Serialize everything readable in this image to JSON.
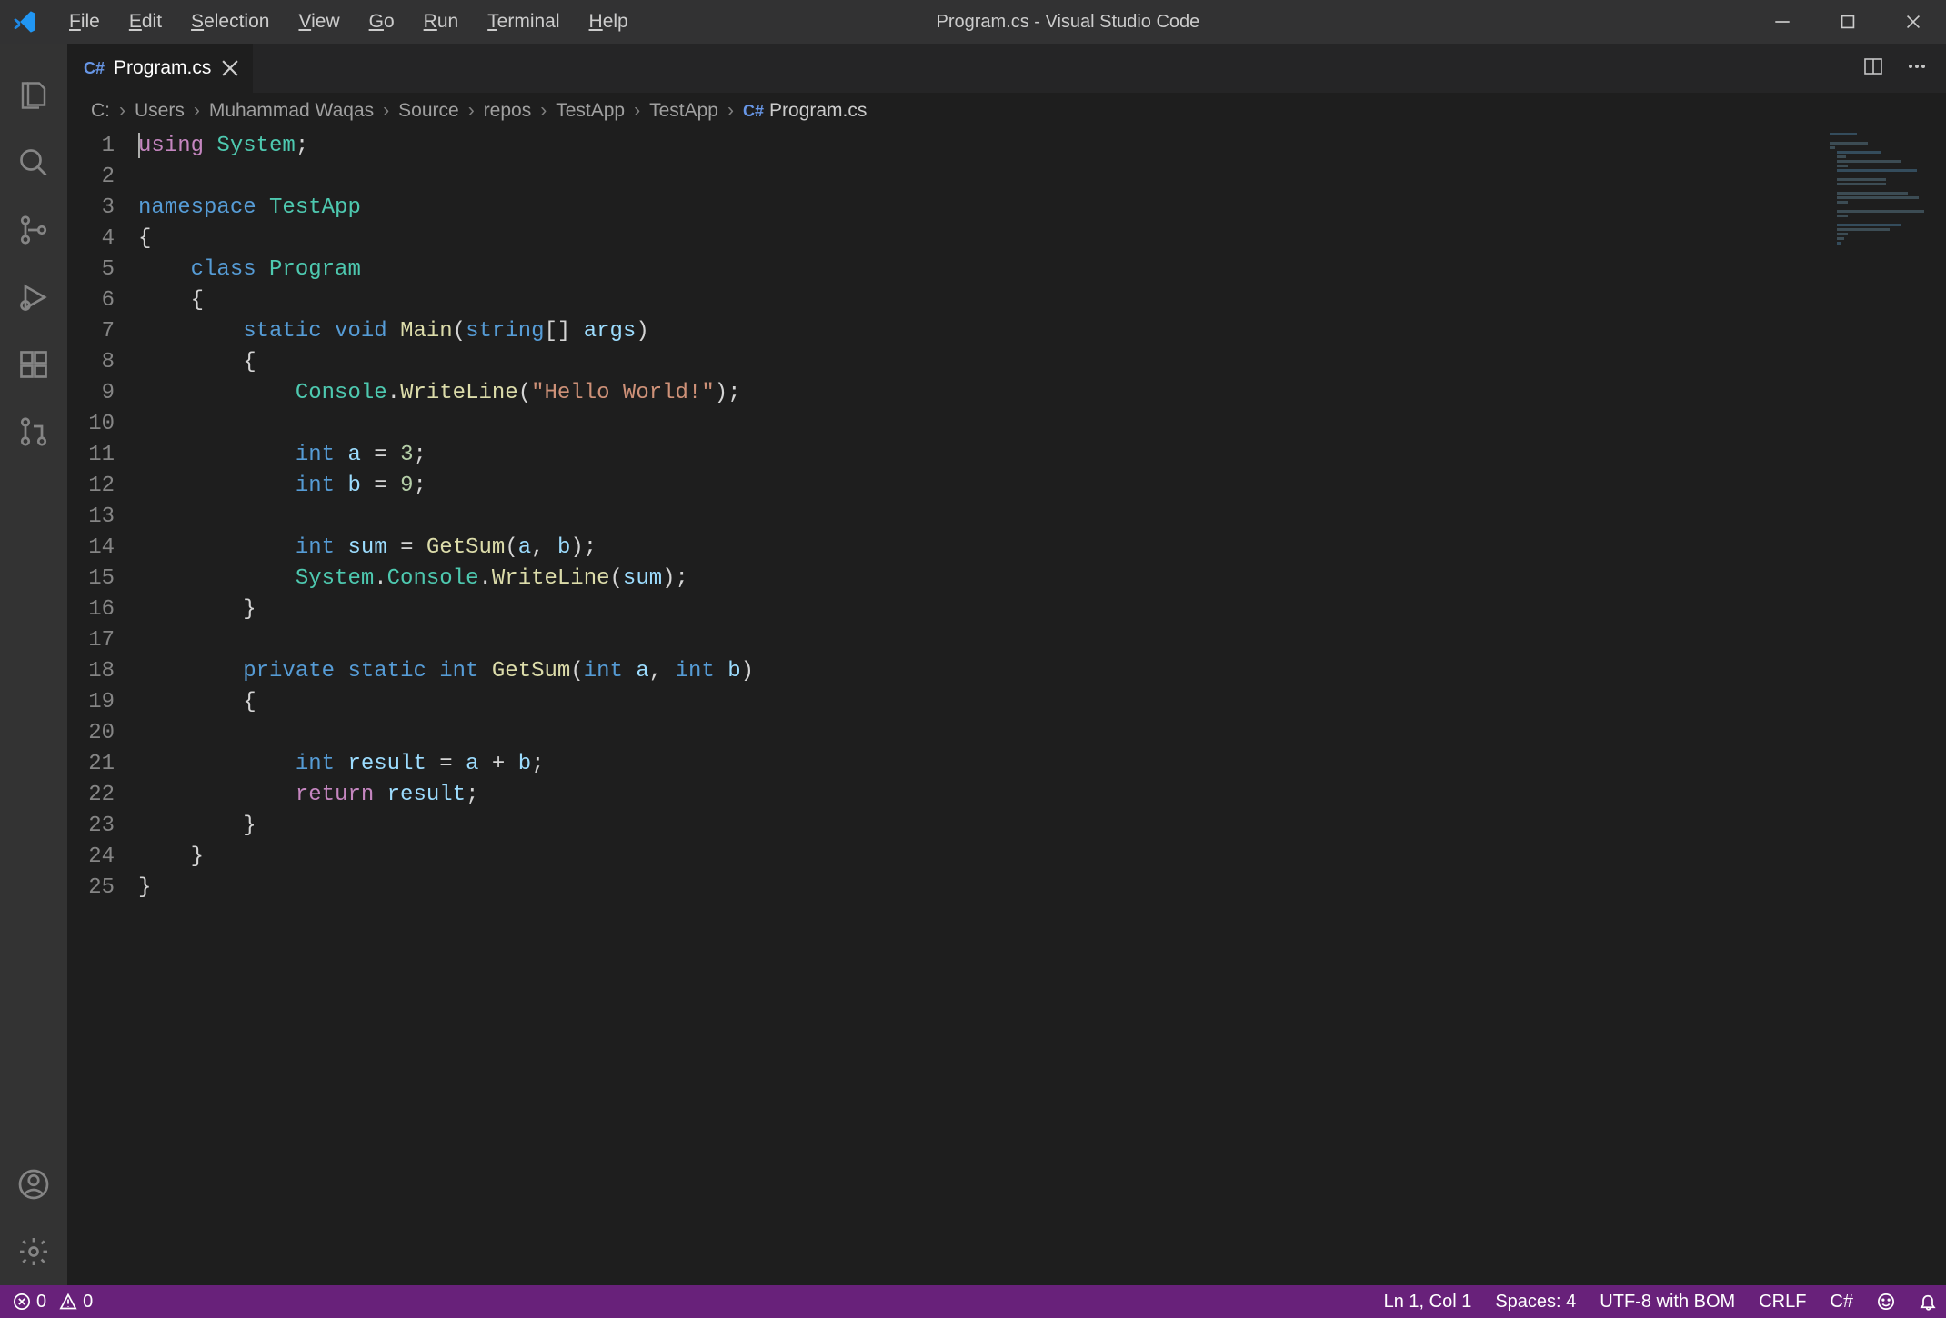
{
  "window": {
    "title": "Program.cs - Visual Studio Code"
  },
  "menubar": {
    "file": "File",
    "edit": "Edit",
    "selection": "Selection",
    "view": "View",
    "go": "Go",
    "run": "Run",
    "terminal": "Terminal",
    "help": "Help"
  },
  "tab": {
    "label": "Program.cs",
    "icon_name": "csharp"
  },
  "breadcrumb": {
    "items": [
      "C:",
      "Users",
      "Muhammad Waqas",
      "Source",
      "repos",
      "TestApp",
      "TestApp",
      "Program.cs"
    ]
  },
  "code": {
    "language": "csharp",
    "line_count": 25,
    "tokens": [
      [
        {
          "t": "cursor"
        },
        {
          "t": "mod",
          "v": "using"
        },
        {
          "t": "punc",
          "v": " "
        },
        {
          "t": "type",
          "v": "System"
        },
        {
          "t": "punc",
          "v": ";"
        }
      ],
      [],
      [
        {
          "t": "kw",
          "v": "namespace"
        },
        {
          "t": "punc",
          "v": " "
        },
        {
          "t": "type",
          "v": "TestApp"
        }
      ],
      [
        {
          "t": "punc",
          "v": "{"
        }
      ],
      [
        {
          "t": "punc",
          "v": "    "
        },
        {
          "t": "kw",
          "v": "class"
        },
        {
          "t": "punc",
          "v": " "
        },
        {
          "t": "cls",
          "v": "Program"
        }
      ],
      [
        {
          "t": "punc",
          "v": "    {"
        }
      ],
      [
        {
          "t": "punc",
          "v": "        "
        },
        {
          "t": "kw",
          "v": "static"
        },
        {
          "t": "punc",
          "v": " "
        },
        {
          "t": "kw",
          "v": "void"
        },
        {
          "t": "punc",
          "v": " "
        },
        {
          "t": "fn",
          "v": "Main"
        },
        {
          "t": "punc",
          "v": "("
        },
        {
          "t": "kw",
          "v": "string"
        },
        {
          "t": "punc",
          "v": "[] "
        },
        {
          "t": "var",
          "v": "args"
        },
        {
          "t": "punc",
          "v": ")"
        }
      ],
      [
        {
          "t": "punc",
          "v": "        {"
        }
      ],
      [
        {
          "t": "punc",
          "v": "            "
        },
        {
          "t": "type",
          "v": "Console"
        },
        {
          "t": "punc",
          "v": "."
        },
        {
          "t": "fn",
          "v": "WriteLine"
        },
        {
          "t": "punc",
          "v": "("
        },
        {
          "t": "str",
          "v": "\"Hello World!\""
        },
        {
          "t": "punc",
          "v": ");"
        }
      ],
      [],
      [
        {
          "t": "punc",
          "v": "            "
        },
        {
          "t": "kw",
          "v": "int"
        },
        {
          "t": "punc",
          "v": " "
        },
        {
          "t": "var",
          "v": "a"
        },
        {
          "t": "punc",
          "v": " = "
        },
        {
          "t": "num",
          "v": "3"
        },
        {
          "t": "punc",
          "v": ";"
        }
      ],
      [
        {
          "t": "punc",
          "v": "            "
        },
        {
          "t": "kw",
          "v": "int"
        },
        {
          "t": "punc",
          "v": " "
        },
        {
          "t": "var",
          "v": "b"
        },
        {
          "t": "punc",
          "v": " = "
        },
        {
          "t": "num",
          "v": "9"
        },
        {
          "t": "punc",
          "v": ";"
        }
      ],
      [],
      [
        {
          "t": "punc",
          "v": "            "
        },
        {
          "t": "kw",
          "v": "int"
        },
        {
          "t": "punc",
          "v": " "
        },
        {
          "t": "var",
          "v": "sum"
        },
        {
          "t": "punc",
          "v": " = "
        },
        {
          "t": "fn",
          "v": "GetSum"
        },
        {
          "t": "punc",
          "v": "("
        },
        {
          "t": "var",
          "v": "a"
        },
        {
          "t": "punc",
          "v": ", "
        },
        {
          "t": "var",
          "v": "b"
        },
        {
          "t": "punc",
          "v": ");"
        }
      ],
      [
        {
          "t": "punc",
          "v": "            "
        },
        {
          "t": "type",
          "v": "System"
        },
        {
          "t": "punc",
          "v": "."
        },
        {
          "t": "type",
          "v": "Console"
        },
        {
          "t": "punc",
          "v": "."
        },
        {
          "t": "fn",
          "v": "WriteLine"
        },
        {
          "t": "punc",
          "v": "("
        },
        {
          "t": "var",
          "v": "sum"
        },
        {
          "t": "punc",
          "v": ");"
        }
      ],
      [
        {
          "t": "punc",
          "v": "        }"
        }
      ],
      [],
      [
        {
          "t": "punc",
          "v": "        "
        },
        {
          "t": "kw",
          "v": "private"
        },
        {
          "t": "punc",
          "v": " "
        },
        {
          "t": "kw",
          "v": "static"
        },
        {
          "t": "punc",
          "v": " "
        },
        {
          "t": "kw",
          "v": "int"
        },
        {
          "t": "punc",
          "v": " "
        },
        {
          "t": "fn",
          "v": "GetSum"
        },
        {
          "t": "punc",
          "v": "("
        },
        {
          "t": "kw",
          "v": "int"
        },
        {
          "t": "punc",
          "v": " "
        },
        {
          "t": "var",
          "v": "a"
        },
        {
          "t": "punc",
          "v": ", "
        },
        {
          "t": "kw",
          "v": "int"
        },
        {
          "t": "punc",
          "v": " "
        },
        {
          "t": "var",
          "v": "b"
        },
        {
          "t": "punc",
          "v": ")"
        }
      ],
      [
        {
          "t": "punc",
          "v": "        {"
        }
      ],
      [],
      [
        {
          "t": "punc",
          "v": "            "
        },
        {
          "t": "kw",
          "v": "int"
        },
        {
          "t": "punc",
          "v": " "
        },
        {
          "t": "var",
          "v": "result"
        },
        {
          "t": "punc",
          "v": " = "
        },
        {
          "t": "var",
          "v": "a"
        },
        {
          "t": "punc",
          "v": " + "
        },
        {
          "t": "var",
          "v": "b"
        },
        {
          "t": "punc",
          "v": ";"
        }
      ],
      [
        {
          "t": "punc",
          "v": "            "
        },
        {
          "t": "mod",
          "v": "return"
        },
        {
          "t": "punc",
          "v": " "
        },
        {
          "t": "var",
          "v": "result"
        },
        {
          "t": "punc",
          "v": ";"
        }
      ],
      [
        {
          "t": "punc",
          "v": "        }"
        }
      ],
      [
        {
          "t": "punc",
          "v": "    }"
        }
      ],
      [
        {
          "t": "punc",
          "v": "}"
        }
      ]
    ]
  },
  "status": {
    "errors": "0",
    "warnings": "0",
    "position": "Ln 1, Col 1",
    "spaces": "Spaces: 4",
    "encoding": "UTF-8 with BOM",
    "eol": "CRLF",
    "language": "C#"
  },
  "colors": {
    "accent": "#68217a",
    "kw": "#569cd6",
    "mod": "#c586c0",
    "type": "#4ec9b0",
    "fn": "#dcdcaa",
    "var": "#9cdcfe",
    "str": "#ce9178",
    "num": "#b5cea8"
  }
}
